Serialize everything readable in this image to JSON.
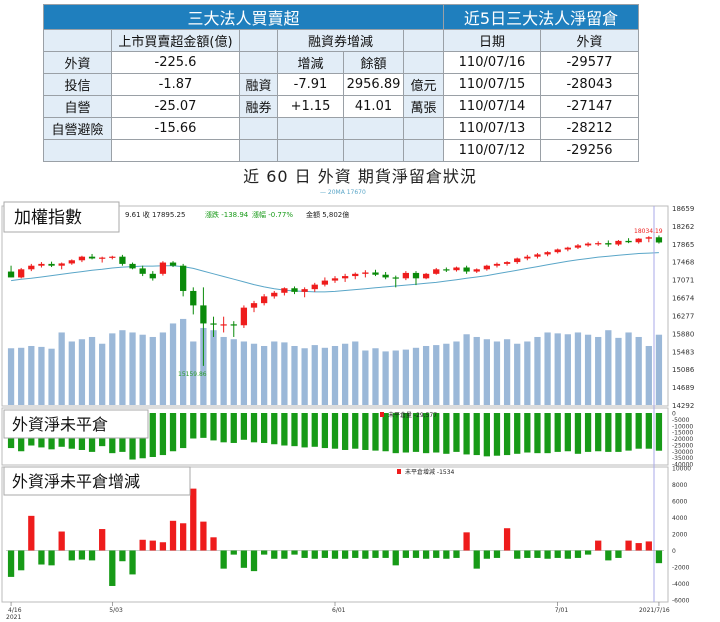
{
  "table": {
    "title_left": "三大法人買賣超",
    "title_right": "近5日三大法人淨留倉",
    "header_amount": "上市買賣超金額(億)",
    "header_margin": "融資券增減",
    "header_change": "增減",
    "header_balance": "餘額",
    "header_date": "日期",
    "header_foreign": "外資",
    "rows": [
      {
        "name": "外資",
        "value": "-225.6"
      },
      {
        "name": "投信",
        "value": "-1.87"
      },
      {
        "name": "自營",
        "value": "-25.07"
      },
      {
        "name": "自營避險",
        "value": "-15.66"
      }
    ],
    "margin": [
      {
        "name": "融資",
        "change": "-7.91",
        "balance": "2956.89",
        "unit": "億元"
      },
      {
        "name": "融券",
        "change": "+1.15",
        "balance": "41.01",
        "unit": "萬張"
      }
    ],
    "net_positions": [
      {
        "date": "110/07/16",
        "foreign": "-29577"
      },
      {
        "date": "110/07/15",
        "foreign": "-28043"
      },
      {
        "date": "110/07/14",
        "foreign": "-27147"
      },
      {
        "date": "110/07/13",
        "foreign": "-28212"
      },
      {
        "date": "110/07/12",
        "foreign": "-29256"
      }
    ]
  },
  "chart_title": "近 60 日 外資 期貨淨留倉狀況",
  "colors": {
    "header": "#1f7fbe",
    "up": "#ee1c1c",
    "down": "#0a8a0a",
    "volume": "#9bb8d8",
    "ma": "#5aa6c8",
    "bear": "#179a17"
  },
  "chart_data": [
    {
      "type": "candlestick",
      "panel_label": "加權指數",
      "legend": "20MA 17670",
      "info": "9.61 收 17895.25",
      "change": "漲跌 -138.94",
      "pct": "漲幅 -0.77%",
      "turnover": "金額 5,802億",
      "last_label": "18034.19",
      "low_label": "15159.86",
      "ylim": [
        14292,
        18659
      ],
      "yticks": [
        "18659",
        "18262",
        "17865",
        "17468",
        "17071",
        "16674",
        "16277",
        "15880",
        "15483",
        "15086",
        "14689",
        "14292"
      ],
      "x_ticks": [
        {
          "i": 0,
          "label": "4/16"
        },
        {
          "i": 10,
          "label": "5/03"
        },
        {
          "i": 32,
          "label": "6/01"
        },
        {
          "i": 54,
          "label": "7/01"
        },
        {
          "i": 64,
          "label": "2021/7/16"
        }
      ],
      "x_year": "2021",
      "ohlc": [
        [
          17250,
          17380,
          17120,
          17120
        ],
        [
          17120,
          17330,
          17100,
          17300
        ],
        [
          17300,
          17420,
          17260,
          17380
        ],
        [
          17380,
          17460,
          17340,
          17420
        ],
        [
          17420,
          17470,
          17350,
          17380
        ],
        [
          17380,
          17450,
          17300,
          17430
        ],
        [
          17430,
          17520,
          17400,
          17500
        ],
        [
          17500,
          17600,
          17460,
          17580
        ],
        [
          17580,
          17640,
          17520,
          17540
        ],
        [
          17540,
          17580,
          17450,
          17560
        ],
        [
          17560,
          17600,
          17520,
          17580
        ],
        [
          17580,
          17620,
          17380,
          17420
        ],
        [
          17420,
          17450,
          17300,
          17320
        ],
        [
          17320,
          17380,
          17150,
          17200
        ],
        [
          17200,
          17260,
          17050,
          17100
        ],
        [
          17200,
          17480,
          17160,
          17450
        ],
        [
          17450,
          17480,
          17350,
          17380
        ],
        [
          17380,
          17420,
          16700,
          16820
        ],
        [
          16820,
          16900,
          16300,
          16500
        ],
        [
          16500,
          16900,
          15159,
          16100
        ],
        [
          16100,
          16250,
          15800,
          16080
        ],
        [
          16080,
          16250,
          15900,
          16080
        ],
        [
          16080,
          16150,
          15800,
          16060
        ],
        [
          16060,
          16500,
          16000,
          16450
        ],
        [
          16450,
          16600,
          16350,
          16550
        ],
        [
          16550,
          16750,
          16500,
          16700
        ],
        [
          16700,
          16820,
          16650,
          16780
        ],
        [
          16780,
          16900,
          16720,
          16880
        ],
        [
          16880,
          16920,
          16750,
          16800
        ],
        [
          16800,
          16900,
          16680,
          16860
        ],
        [
          16860,
          17000,
          16800,
          16960
        ],
        [
          16960,
          17120,
          16920,
          17050
        ],
        [
          17050,
          17150,
          17000,
          17100
        ],
        [
          17100,
          17200,
          17020,
          17150
        ],
        [
          17150,
          17230,
          17080,
          17200
        ],
        [
          17200,
          17280,
          17120,
          17230
        ],
        [
          17230,
          17290,
          17150,
          17180
        ],
        [
          17180,
          17240,
          17080,
          17120
        ],
        [
          17120,
          17160,
          16900,
          17100
        ],
        [
          17100,
          17260,
          17060,
          17220
        ],
        [
          17220,
          17260,
          16950,
          17100
        ],
        [
          17100,
          17220,
          17080,
          17200
        ],
        [
          17200,
          17330,
          17180,
          17300
        ],
        [
          17300,
          17340,
          17240,
          17280
        ],
        [
          17280,
          17360,
          17250,
          17340
        ],
        [
          17340,
          17380,
          17200,
          17250
        ],
        [
          17250,
          17320,
          17220,
          17300
        ],
        [
          17300,
          17400,
          17270,
          17380
        ],
        [
          17380,
          17450,
          17340,
          17420
        ],
        [
          17420,
          17480,
          17380,
          17460
        ],
        [
          17460,
          17560,
          17420,
          17540
        ],
        [
          17540,
          17620,
          17500,
          17580
        ],
        [
          17580,
          17660,
          17540,
          17630
        ],
        [
          17630,
          17700,
          17590,
          17680
        ],
        [
          17680,
          17760,
          17650,
          17740
        ],
        [
          17740,
          17800,
          17700,
          17780
        ],
        [
          17780,
          17860,
          17750,
          17830
        ],
        [
          17830,
          17900,
          17800,
          17870
        ],
        [
          17870,
          17920,
          17820,
          17880
        ],
        [
          17880,
          17940,
          17800,
          17850
        ],
        [
          17850,
          17950,
          17820,
          17930
        ],
        [
          17930,
          17990,
          17880,
          17900
        ],
        [
          17900,
          17990,
          17870,
          17980
        ],
        [
          17980,
          18034,
          17900,
          18010
        ],
        [
          18010,
          18050,
          17870,
          17895
        ]
      ],
      "ma": [
        17050,
        17080,
        17100,
        17130,
        17160,
        17190,
        17220,
        17250,
        17280,
        17300,
        17330,
        17350,
        17360,
        17370,
        17370,
        17380,
        17380,
        17360,
        17320,
        17260,
        17200,
        17140,
        17080,
        17020,
        16960,
        16910,
        16870,
        16840,
        16820,
        16810,
        16800,
        16800,
        16810,
        16830,
        16850,
        16870,
        16890,
        16910,
        16930,
        16950,
        16970,
        16990,
        17010,
        17040,
        17070,
        17100,
        17130,
        17160,
        17200,
        17240,
        17280,
        17320,
        17360,
        17400,
        17440,
        17480,
        17510,
        17540,
        17570,
        17590,
        17610,
        17630,
        17650,
        17660,
        17670
      ],
      "volume": [
        15550,
        15560,
        15600,
        15580,
        15540,
        15900,
        15700,
        15750,
        15800,
        15650,
        15880,
        15950,
        15900,
        15850,
        15800,
        15900,
        16100,
        16200,
        15700,
        16000,
        15950,
        15800,
        15750,
        15700,
        15650,
        15600,
        15700,
        15680,
        15600,
        15550,
        15620,
        15560,
        15600,
        15650,
        15700,
        15500,
        15550,
        15480,
        15500,
        15520,
        15560,
        15600,
        15620,
        15650,
        15700,
        15860,
        15800,
        15750,
        15700,
        15750,
        15650,
        15700,
        15800,
        15900,
        15880,
        15860,
        15900,
        15850,
        15800,
        15950,
        15780,
        15900,
        15800,
        15600,
        15850
      ]
    },
    {
      "type": "bar",
      "panel_label": "外資淨未平倉",
      "legend": "未平倉量 -29,577",
      "ylim": [
        -40000,
        0
      ],
      "yticks": [
        "0",
        "-5000",
        "-10000",
        "-15000",
        "-20000",
        "-25000",
        "-30000",
        "-35000",
        "-40000"
      ],
      "values": [
        -27500,
        -30000,
        -25500,
        -27000,
        -28500,
        -26500,
        -28000,
        -29000,
        -30500,
        -26000,
        -31500,
        -30500,
        -36500,
        -35500,
        -34500,
        -33000,
        -30000,
        -27500,
        -20000,
        -19500,
        -21500,
        -23000,
        -23500,
        -21000,
        -23000,
        -23500,
        -24500,
        -25500,
        -26000,
        -27000,
        -26500,
        -27500,
        -28000,
        -29000,
        -28000,
        -29000,
        -29500,
        -30000,
        -31500,
        -31000,
        -30500,
        -31500,
        -31000,
        -32000,
        -30500,
        -32500,
        -33000,
        -34000,
        -33500,
        -33000,
        -32000,
        -31000,
        -31500,
        -31500,
        -30500,
        -30000,
        -32000,
        -30500,
        -30000,
        -30500,
        -30500,
        -29500,
        -28000,
        -28000,
        -29577
      ]
    },
    {
      "type": "bar",
      "panel_label": "外資淨未平倉增減",
      "legend": "未平倉增減 -1534",
      "ylim": [
        -6000,
        10000
      ],
      "yticks": [
        "10000",
        "8000",
        "6000",
        "4000",
        "2000",
        "0",
        "-2000",
        "-4000",
        "-6000"
      ],
      "values": [
        -3200,
        -2400,
        4200,
        -1700,
        -1800,
        2300,
        -1200,
        -1100,
        -1200,
        2600,
        -4300,
        -1300,
        -2900,
        1300,
        1200,
        1000,
        3600,
        3300,
        7500,
        3500,
        1600,
        -2200,
        -500,
        -2100,
        -2500,
        -500,
        -1000,
        -1000,
        -500,
        -900,
        -1000,
        -900,
        -1000,
        -1000,
        -900,
        -1000,
        -900,
        -900,
        -1800,
        -900,
        -900,
        -1000,
        -900,
        -1000,
        -900,
        2200,
        -2200,
        -1000,
        -900,
        2700,
        -1000,
        -900,
        -900,
        -1000,
        -900,
        -1000,
        -900,
        -500,
        1200,
        -1200,
        -900,
        1200,
        900,
        1100,
        -1534
      ]
    }
  ]
}
